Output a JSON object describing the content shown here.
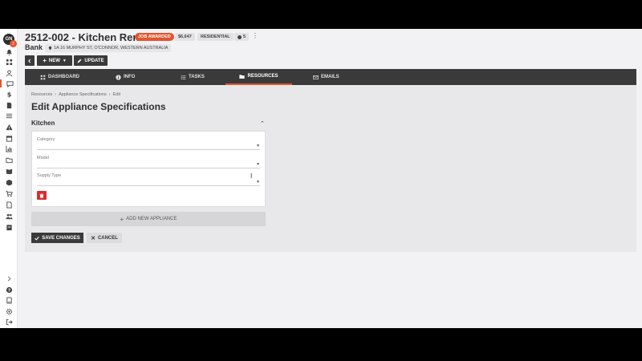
{
  "user": {
    "initials": "GN",
    "notifications": "2"
  },
  "header": {
    "title": "2512-002 - Kitchen Reno",
    "status_badge": "JOB AWARDED",
    "amount": "$6,647",
    "type_badge": "RESIDENTIAL",
    "count_badge": "5",
    "client": "Bank",
    "address": "1A 16 MURPHY ST, O'CONNOR, WESTERN AUSTRALIA"
  },
  "actions": {
    "new_label": "NEW",
    "update_label": "UPDATE"
  },
  "tabs": [
    {
      "label": "DASHBOARD",
      "icon": "grid-icon"
    },
    {
      "label": "INFO",
      "icon": "info-icon"
    },
    {
      "label": "TASKS",
      "icon": "list-icon"
    },
    {
      "label": "RESOURCES",
      "icon": "folder-icon",
      "active": true
    },
    {
      "label": "EMAILS",
      "icon": "mail-icon"
    }
  ],
  "breadcrumb": [
    "Resources",
    "Appliance Specifications",
    "Edit"
  ],
  "page_title": "Edit Appliance Specifications",
  "section": {
    "title": "Kitchen",
    "fields": [
      {
        "label": "Category",
        "value": ""
      },
      {
        "label": "Model",
        "value": ""
      },
      {
        "label": "Supply Type",
        "value": ""
      }
    ]
  },
  "add_label": "ADD NEW APPLIANCE",
  "save_label": "SAVE CHANGES",
  "cancel_label": "CANCEL",
  "colors": {
    "accent": "#e5532d",
    "dark": "#3a3a3a",
    "danger": "#d32f2f"
  }
}
